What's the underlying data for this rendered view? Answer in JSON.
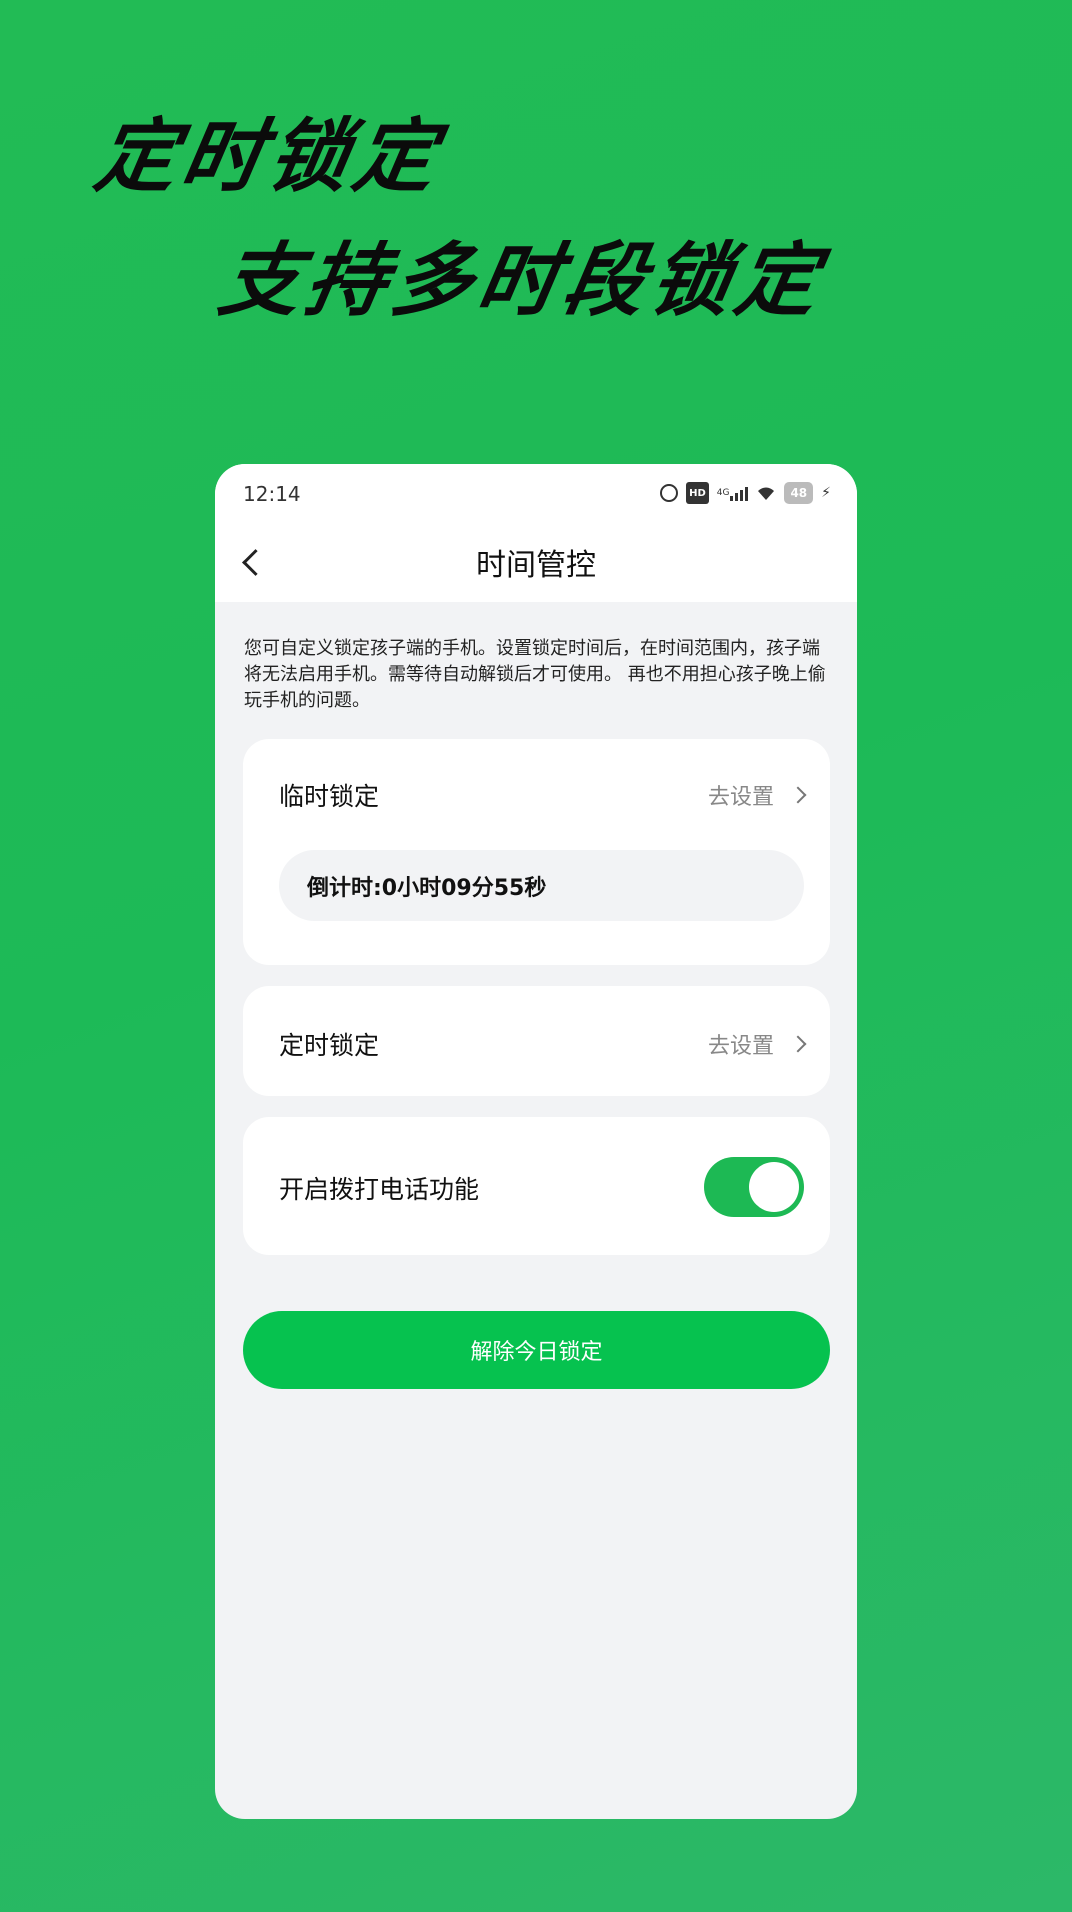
{
  "promo": {
    "headline_1": "定时锁定",
    "headline_2": "支持多时段锁定"
  },
  "status_bar": {
    "time": "12:14",
    "hd_label": "HD",
    "network": "4G",
    "battery": "48"
  },
  "nav": {
    "title": "时间管控"
  },
  "description": "您可自定义锁定孩子端的手机。设置锁定时间后，在时间范围内，孩子端将无法启用手机。需等待自动解锁后才可使用。 再也不用担心孩子晚上偷玩手机的问题。",
  "temp_lock": {
    "label": "临时锁定",
    "action": "去设置",
    "countdown": "倒计时:0小时09分55秒"
  },
  "schedule_lock": {
    "label": "定时锁定",
    "action": "去设置"
  },
  "call_function": {
    "label": "开启拨打电话功能",
    "enabled": true
  },
  "unlock_button": {
    "label": "解除今日锁定"
  },
  "colors": {
    "background_green": "#22bb55",
    "accent_green": "#06c24f",
    "toggle_on": "#1db954"
  }
}
